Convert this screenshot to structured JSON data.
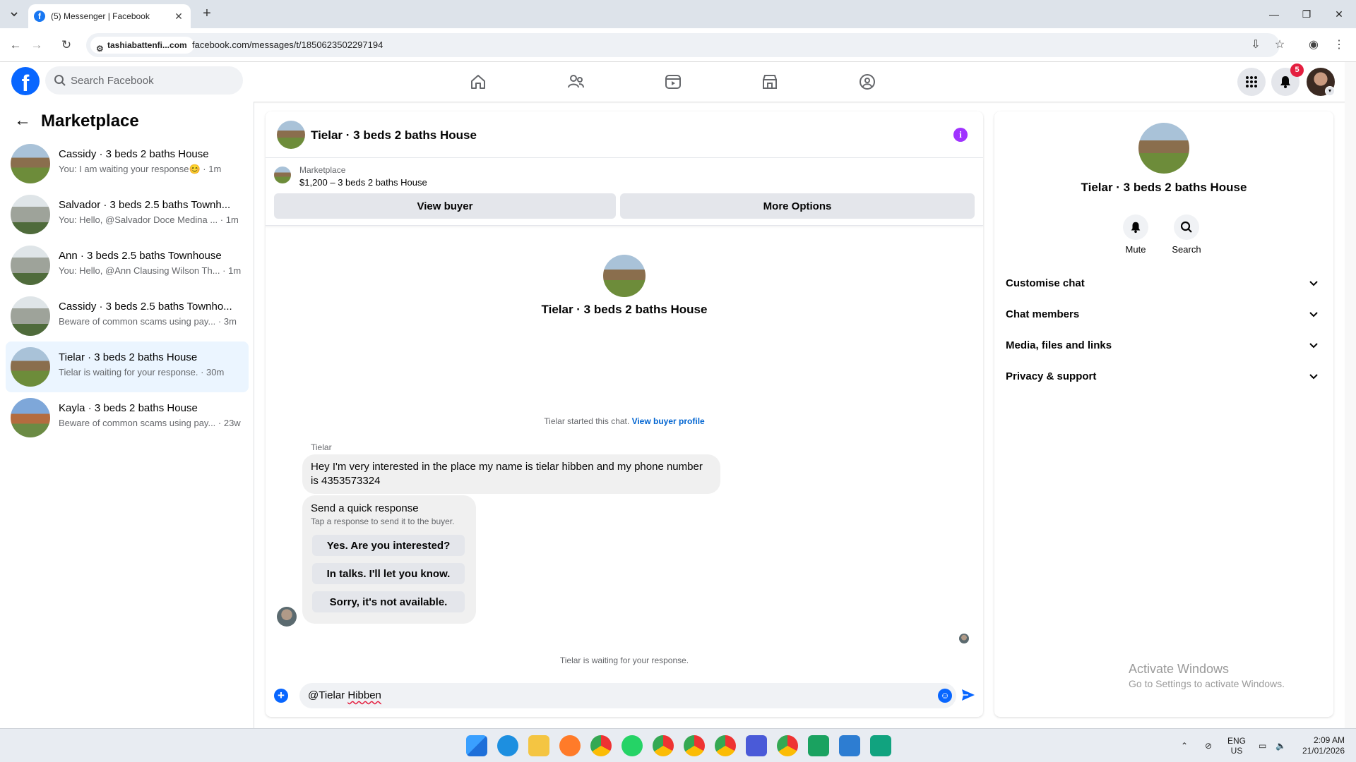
{
  "browser": {
    "tab_title": "(5) Messenger | Facebook",
    "site_chip": "tashiabattenfi...com",
    "url": "facebook.com/messages/t/1850623502297194"
  },
  "fb": {
    "search_placeholder": "Search Facebook",
    "notification_count": "5"
  },
  "sidebar": {
    "title": "Marketplace",
    "conversations": [
      {
        "name": "Cassidy · 3 beds 2 baths House",
        "preview": "You: I am waiting your response😊 · 1m",
        "active": false
      },
      {
        "name": "Salvador · 3 beds 2.5 baths Townh...",
        "preview": "You: Hello, @Salvador Doce Medina ... · 1m",
        "active": false
      },
      {
        "name": "Ann · 3 beds 2.5 baths Townhouse",
        "preview": "You: Hello, @Ann Clausing Wilson Th... · 1m",
        "active": false
      },
      {
        "name": "Cassidy · 3 beds 2.5 baths Townho...",
        "preview": "Beware of common scams using pay... · 3m",
        "active": false
      },
      {
        "name": "Tielar · 3 beds 2 baths House",
        "preview": "Tielar is waiting for your response. · 30m",
        "active": true
      },
      {
        "name": "Kayla · 3 beds 2 baths House",
        "preview": "Beware of common scams using pay... · 23w",
        "active": false
      }
    ]
  },
  "chat": {
    "title": "Tielar · 3 beds 2 baths House",
    "listing_source": "Marketplace",
    "listing_price": "$1,200 – 3 beds 2 baths House",
    "view_buyer": "View buyer",
    "more_options": "More Options",
    "intro_name": "Tielar · 3 beds 2 baths House",
    "started_text": "Tielar started this chat.",
    "view_buyer_profile": "View buyer profile",
    "sender": "Tielar",
    "message": "Hey I'm very interested in the place my name is tielar hibben and my phone number is 4353573324",
    "quick_title": "Send a quick response",
    "quick_sub": "Tap a response to send it to the buyer.",
    "quick_options": [
      "Yes. Are you interested?",
      "In talks. I'll let you know.",
      "Sorry, it's not available."
    ],
    "waiting": "Tielar is waiting for your response.",
    "compose_prefix": "@Tielar ",
    "compose_name": "Hibben"
  },
  "info": {
    "name": "Tielar · 3 beds 2 baths House",
    "mute_label": "Mute",
    "search_label": "Search",
    "sections": [
      "Customise chat",
      "Chat members",
      "Media, files and links",
      "Privacy & support"
    ]
  },
  "watermark": {
    "title": "Activate Windows",
    "subtitle": "Go to Settings to activate Windows."
  },
  "taskbar": {
    "lang": "ENG",
    "region": "US",
    "time": "2:09 AM",
    "date": "21/01/2026"
  }
}
